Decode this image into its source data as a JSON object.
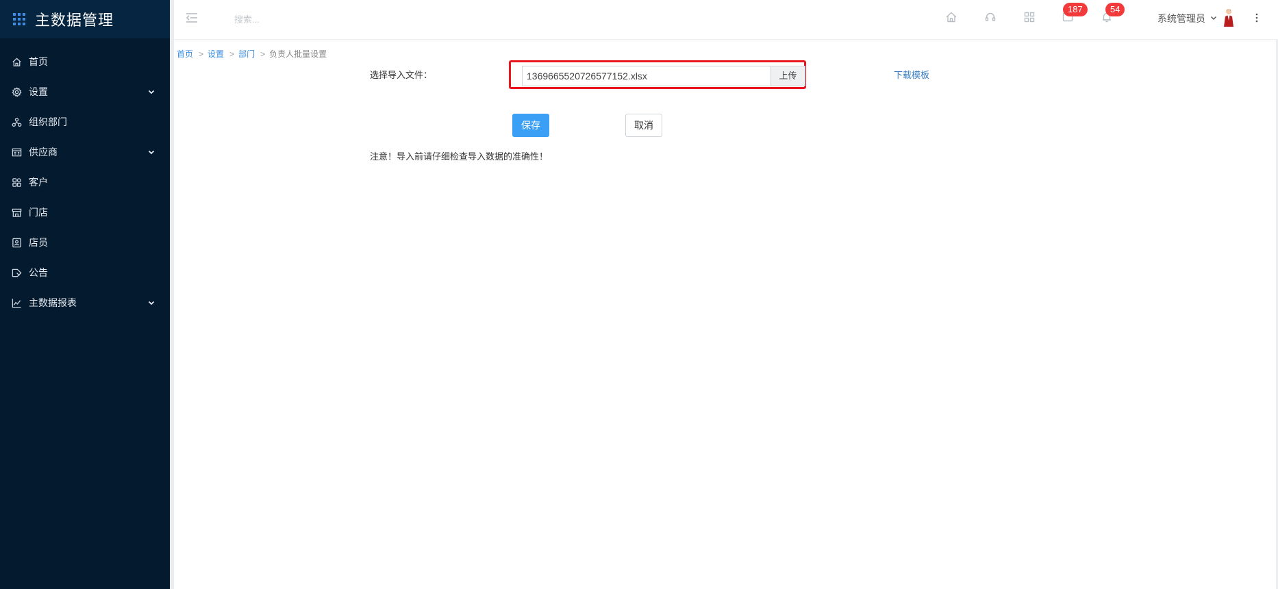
{
  "app": {
    "title": "主数据管理"
  },
  "sidebar": {
    "items": [
      {
        "label": "首页",
        "icon": "home-icon",
        "has_arrow": false
      },
      {
        "label": "设置",
        "icon": "gear-icon",
        "has_arrow": true
      },
      {
        "label": "组织部门",
        "icon": "org-tree-icon",
        "has_arrow": false
      },
      {
        "label": "供应商",
        "icon": "supplier-icon",
        "has_arrow": true
      },
      {
        "label": "客户",
        "icon": "customer-icon",
        "has_arrow": false
      },
      {
        "label": "门店",
        "icon": "store-icon",
        "has_arrow": false
      },
      {
        "label": "店员",
        "icon": "staff-icon",
        "has_arrow": false
      },
      {
        "label": "公告",
        "icon": "announcement-icon",
        "has_arrow": false
      },
      {
        "label": "主数据报表",
        "icon": "chart-icon",
        "has_arrow": true
      }
    ]
  },
  "header": {
    "search_placeholder": "搜索...",
    "messages_count": "187",
    "notifications_count": "54",
    "user_name": "系统管理员"
  },
  "breadcrumb": {
    "items": [
      "首页",
      "设置",
      "部门"
    ],
    "current": "负责人批量设置",
    "separator": ">"
  },
  "form": {
    "file_label": "选择导入文件：",
    "file_value": "1369665520726577152.xlsx",
    "upload_label": "上传",
    "download_label": "下载模板",
    "save_label": "保存",
    "cancel_label": "取消",
    "notice": "注意！导入前请仔细检查导入数据的准确性！"
  },
  "colors": {
    "sidebar_bg": "#031a2f",
    "primary": "#3ba0f5",
    "badge": "#f23a3a",
    "highlight": "#e8171e"
  }
}
